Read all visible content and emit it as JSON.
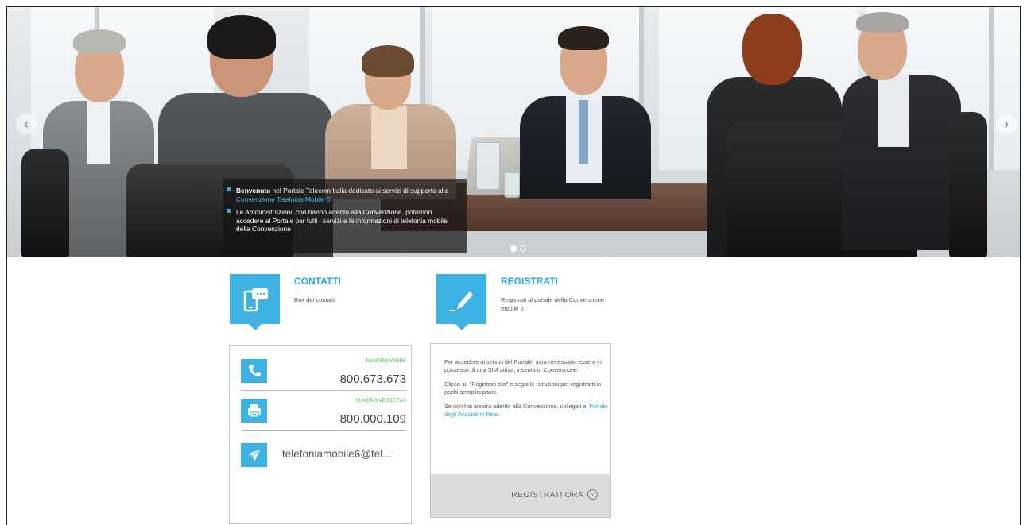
{
  "hero": {
    "prev_arrow": "‹",
    "next_arrow": "›",
    "caption": {
      "item1_strong": "Benvenuto",
      "item1_text": " nel Portale Telecom Italia dedicato ai servizi di supporto alla ",
      "item1_link": "Convenzione Telefonia Mobile 6.",
      "item2_text": "Le Amministrazioni, che hanno aderito alla Convenzione, potranno accedere al Portale per tutti i servizi e le informazioni di telefonia mobile della Convenzione"
    },
    "slides_count": 2,
    "active_slide": 1
  },
  "contatti": {
    "title": "CONTATTI",
    "subtitle": "Box dei contatti",
    "phone": {
      "label": "NUMERO VERDE",
      "number": "800.673.673"
    },
    "fax": {
      "label": "NUMERO VERDE FAX",
      "number": "800.000.109"
    },
    "email": "telefoniamobile6@tel..."
  },
  "registrati": {
    "title": "REGISTRATI",
    "subtitle": "Registrati al portale della Convenzione mobile 6",
    "para1": "Per accedere ai servizi del Portale, sarà necessario essere in possesso di una SIM attiva, inserita in Convenzione.",
    "para2": "Clicca su \"Registrati ora\" e segui le istruzioni per registrarti in pochi semplici passi.",
    "para3_text": "Se non hai ancora aderito alla Convenzione, collegati al ",
    "para3_link": "Portale degli Acquisti in Rete.",
    "button": "REGISTRATI ORA"
  },
  "colors": {
    "accent_blue": "#3eb3e3",
    "title_blue": "#2aa6dc",
    "green_label": "#31b53d"
  }
}
